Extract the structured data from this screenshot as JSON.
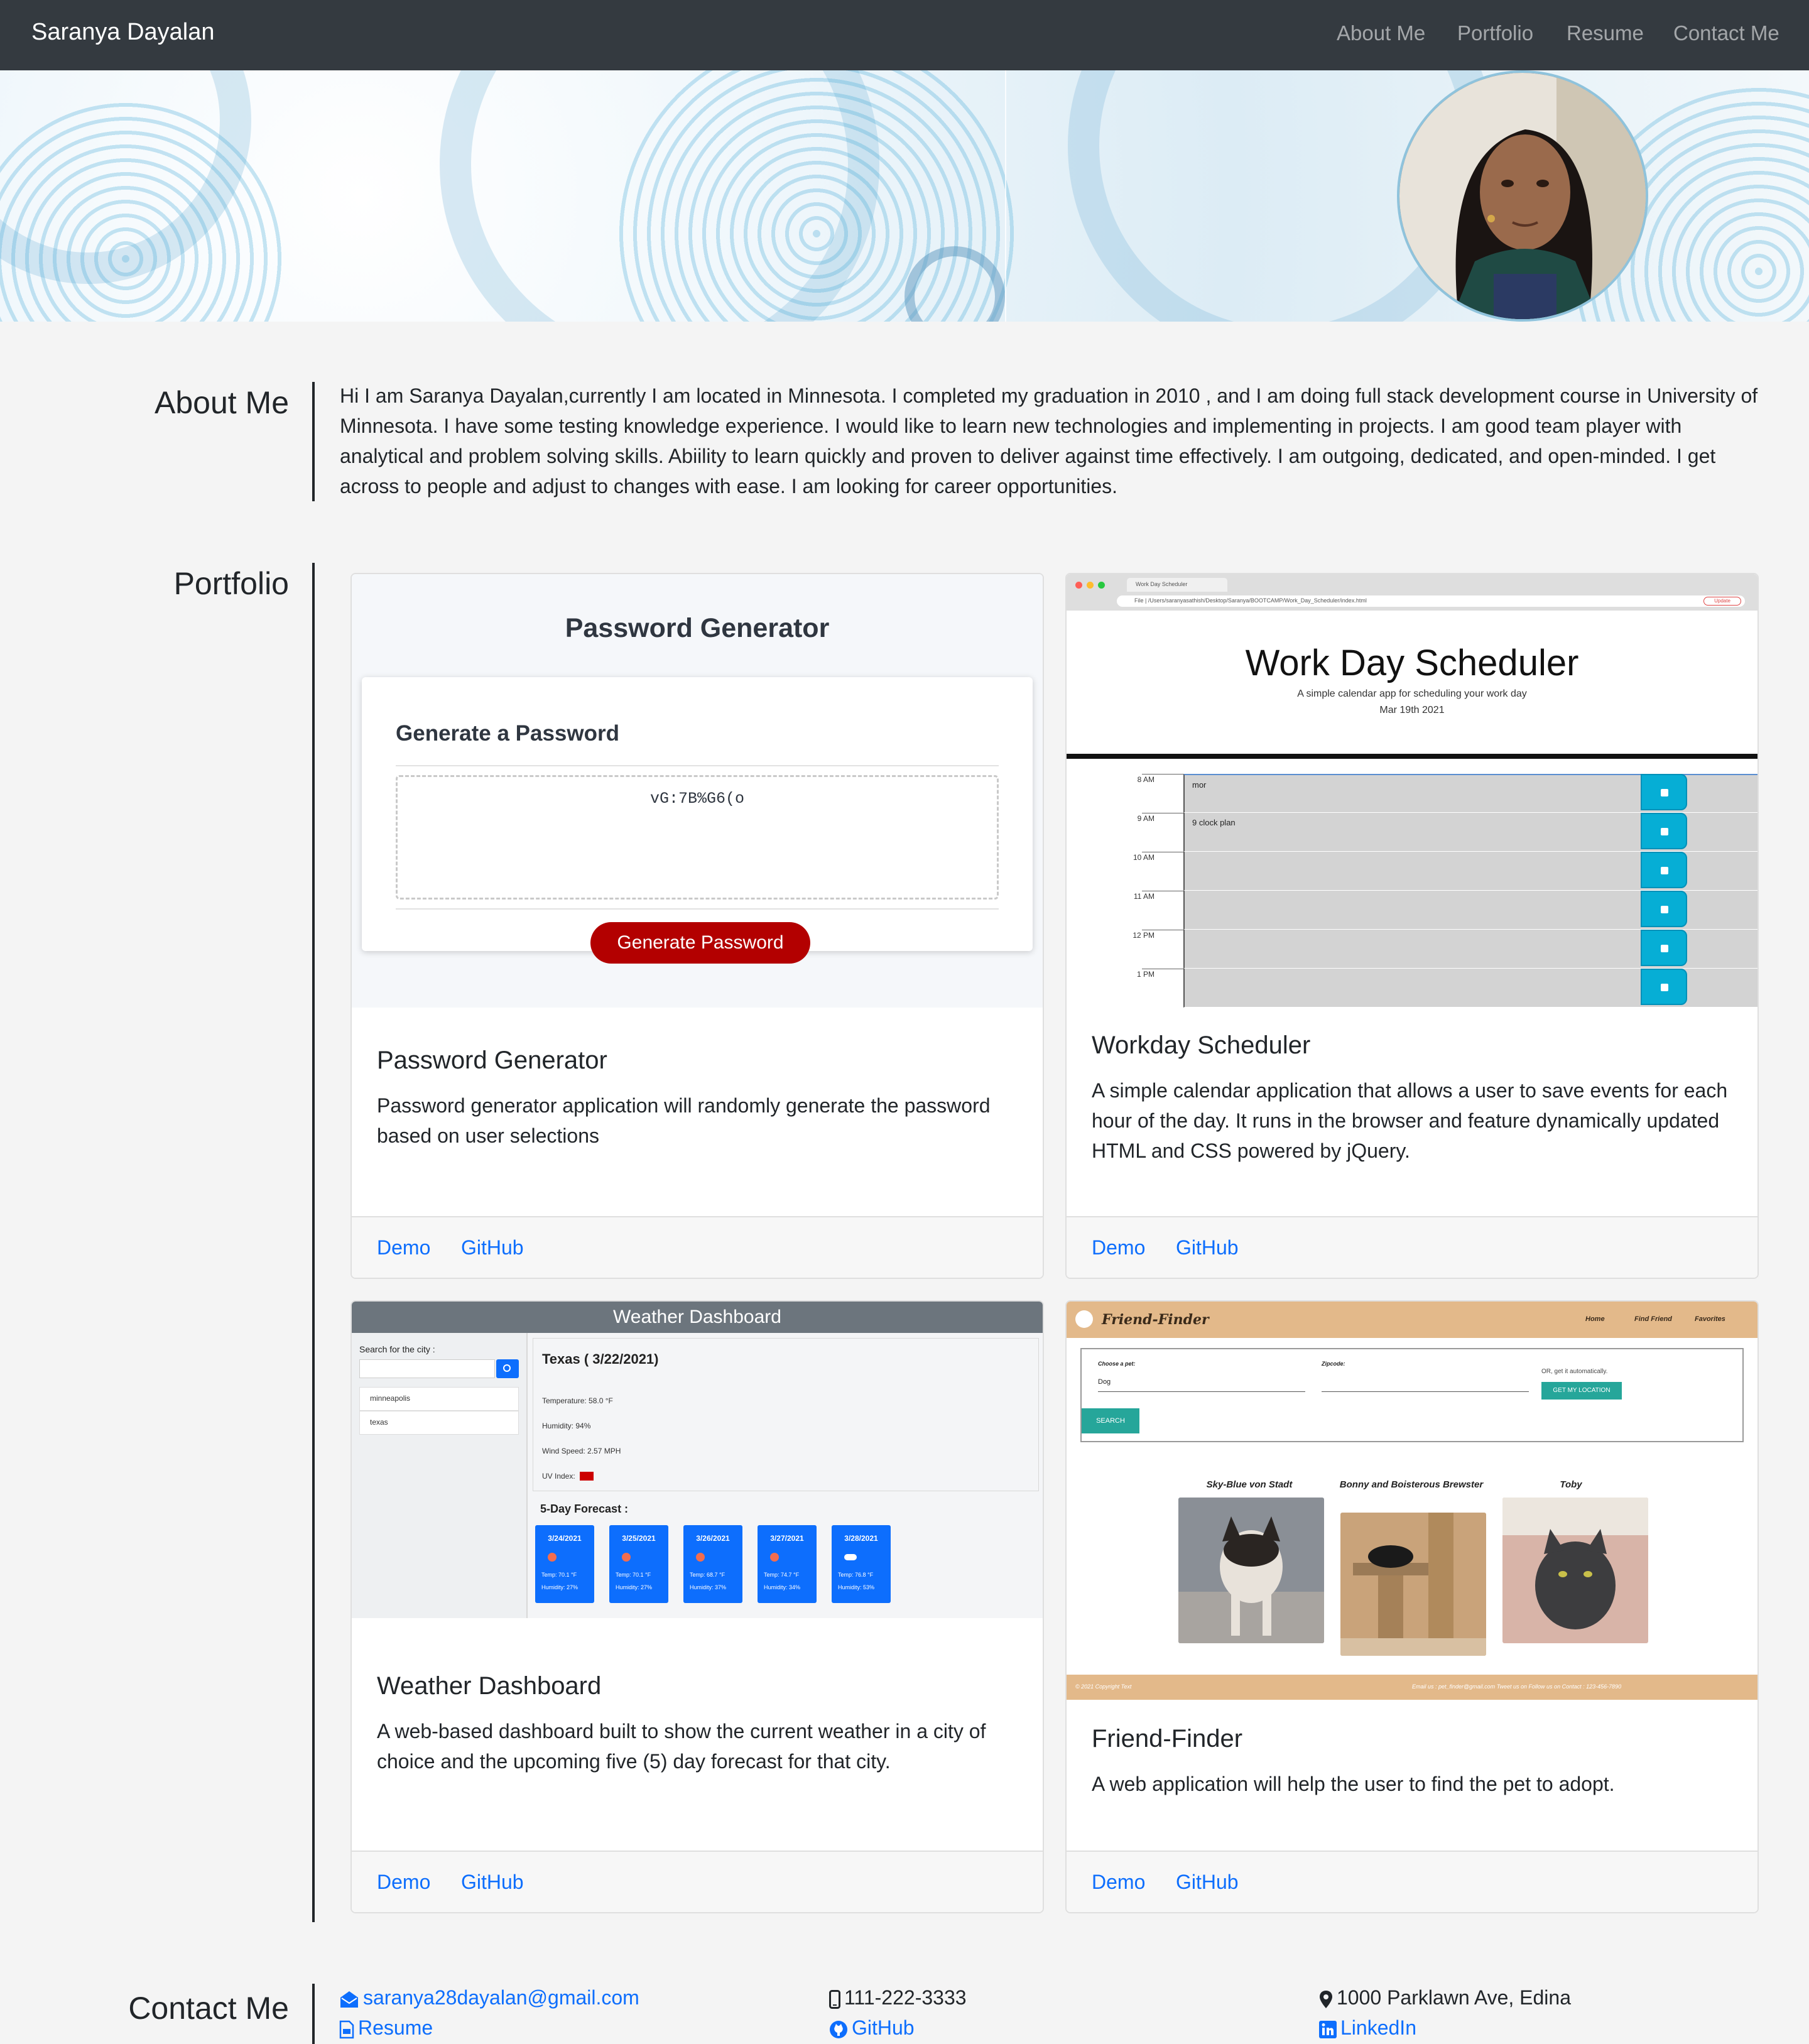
{
  "navbar": {
    "brand": "Saranya Dayalan",
    "links": [
      "About Me",
      "Portfolio",
      "Resume",
      "Contact Me"
    ]
  },
  "about": {
    "title": "About Me",
    "text": "Hi I am Saranya Dayalan,currently I am located in Minnesota. I completed my graduation in 2010 , and I am doing full stack development course in University of Minnesota. I have some testing knowledge experience. I would like to learn new technologies and implementing in projects. I am good team player with analytical and problem solving skills. Abiility to learn quickly and proven to deliver against time effectively. I am outgoing, dedicated, and open-minded. I get across to people and adjust to changes with ease. I am looking for career opportunities."
  },
  "portfolio": {
    "title": "Portfolio",
    "projects": [
      {
        "title": "Password Generator",
        "description": "Password generator application will randomly generate the password based on user selections",
        "demo_label": "Demo",
        "github_label": "GitHub",
        "screenshot": {
          "heading": "Password Generator",
          "subheading": "Generate a Password",
          "password": "vG:7B%G6(o",
          "button": "Generate Password"
        }
      },
      {
        "title": "Workday Scheduler",
        "description": "A simple calendar application that allows a user to save events for each hour of the day. It runs in the browser and feature dynamically updated HTML and CSS powered by jQuery.",
        "demo_label": "Demo",
        "github_label": "GitHub",
        "screenshot": {
          "tab": "Work Day Scheduler",
          "url": "File | /Users/saranyasathish/Desktop/Saranya/BOOTCAMP/Work_Day_Scheduler/index.html",
          "update": "Update",
          "heading": "Work Day Scheduler",
          "lead": "A simple calendar app for scheduling your work day",
          "date": "Mar 19th 2021",
          "hours": [
            {
              "label": "8 AM",
              "text": "mor"
            },
            {
              "label": "9 AM",
              "text": "9 clock plan"
            },
            {
              "label": "10 AM",
              "text": ""
            },
            {
              "label": "11 AM",
              "text": ""
            },
            {
              "label": "12 PM",
              "text": ""
            },
            {
              "label": "1 PM",
              "text": ""
            }
          ]
        }
      },
      {
        "title": "Weather Dashboard",
        "description": "A web-based dashboard built to show the current weather in a city of choice and the upcoming five (5) day forecast for that city.",
        "demo_label": "Demo",
        "github_label": "GitHub",
        "screenshot": {
          "header": "Weather Dashboard",
          "search_label": "Search for the city :",
          "history": [
            "minneapolis",
            "texas"
          ],
          "city": "Texas ( 3/22/2021)",
          "temperature": "Temperature: 58.0 °F",
          "humidity": "Humidity: 94%",
          "wind": "Wind Speed: 2.57 MPH",
          "uv": "UV Index:",
          "forecast_heading": "5-Day Forecast :",
          "forecast": [
            {
              "date": "3/24/2021",
              "temp": "Temp: 70.1 °F",
              "humidity": "Humidity: 27%"
            },
            {
              "date": "3/25/2021",
              "temp": "Temp: 70.1 °F",
              "humidity": "Humidity: 27%"
            },
            {
              "date": "3/26/2021",
              "temp": "Temp: 68.7 °F",
              "humidity": "Humidity: 37%"
            },
            {
              "date": "3/27/2021",
              "temp": "Temp: 74.7 °F",
              "humidity": "Humidity: 34%"
            },
            {
              "date": "3/28/2021",
              "temp": "Temp: 76.8 °F",
              "humidity": "Humidity: 53%"
            }
          ]
        }
      },
      {
        "title": "Friend-Finder",
        "description": "A web application will help the user to find the pet to adopt.",
        "demo_label": "Demo",
        "github_label": "GitHub",
        "screenshot": {
          "logo": "Friend-Finder",
          "nav": [
            "Home",
            "Find Friend",
            "Favorites"
          ],
          "choose_label": "Choose a pet:",
          "choose_value": "Dog",
          "zipcode_label": "Zipcode:",
          "or_text": "OR, get it automatically.",
          "location_button": "GET MY LOCATION",
          "search_button": "SEARCH",
          "pets": [
            "Sky-Blue von Stadt",
            "Bonny and Boisterous Brewster",
            "Toby"
          ],
          "footer_left": "© 2021 Copyright Text",
          "footer_right": "Email us : pet_finder@gmail.com    Tweet us on    Follow us on    Contact : 123-456-7890"
        }
      }
    ]
  },
  "contact": {
    "title": "Contact Me",
    "email": "saranya28dayalan@gmail.com",
    "resume": "Resume",
    "phone": "111-222-3333",
    "github": "GitHub",
    "address": "1000 Parklawn Ave, Edina",
    "linkedin": "LinkedIn"
  },
  "colors": {
    "navbar": "#343a40",
    "link": "#0d6efd",
    "page_background": "#f4f4f4",
    "generate_button": "#b30000"
  }
}
